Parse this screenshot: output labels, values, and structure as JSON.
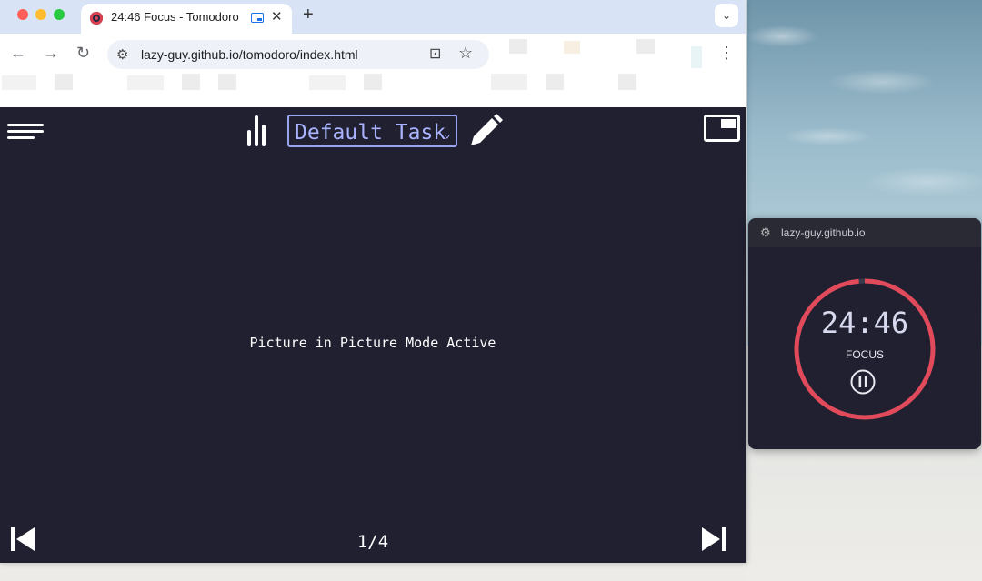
{
  "browser": {
    "tab": {
      "title": "24:46 Focus - Tomodoro",
      "close_glyph": "✕"
    },
    "new_tab_glyph": "+",
    "tab_menu_glyph": "⌄",
    "nav": {
      "back_glyph": "←",
      "forward_glyph": "→",
      "reload_glyph": "↻"
    },
    "url": "lazy-guy.github.io/tomodoro/index.html",
    "menu_glyph": "⋮"
  },
  "app": {
    "task_name": "Default Task",
    "task_caret": "⌄",
    "pip_message": "Picture in Picture Mode Active",
    "pager": "1/4"
  },
  "pip_window": {
    "host": "lazy-guy.github.io",
    "time": "24:46",
    "mode_label": "FOCUS",
    "progress_remaining_fraction": 0.986
  },
  "colors": {
    "app_bg": "#202031",
    "accent": "#9aa3f0",
    "ring": "#e04a5a"
  },
  "icons": [
    "menu-icon",
    "stats-icon",
    "edit-icon",
    "pip-icon",
    "skip-previous-icon",
    "skip-next-icon",
    "pause-icon"
  ]
}
